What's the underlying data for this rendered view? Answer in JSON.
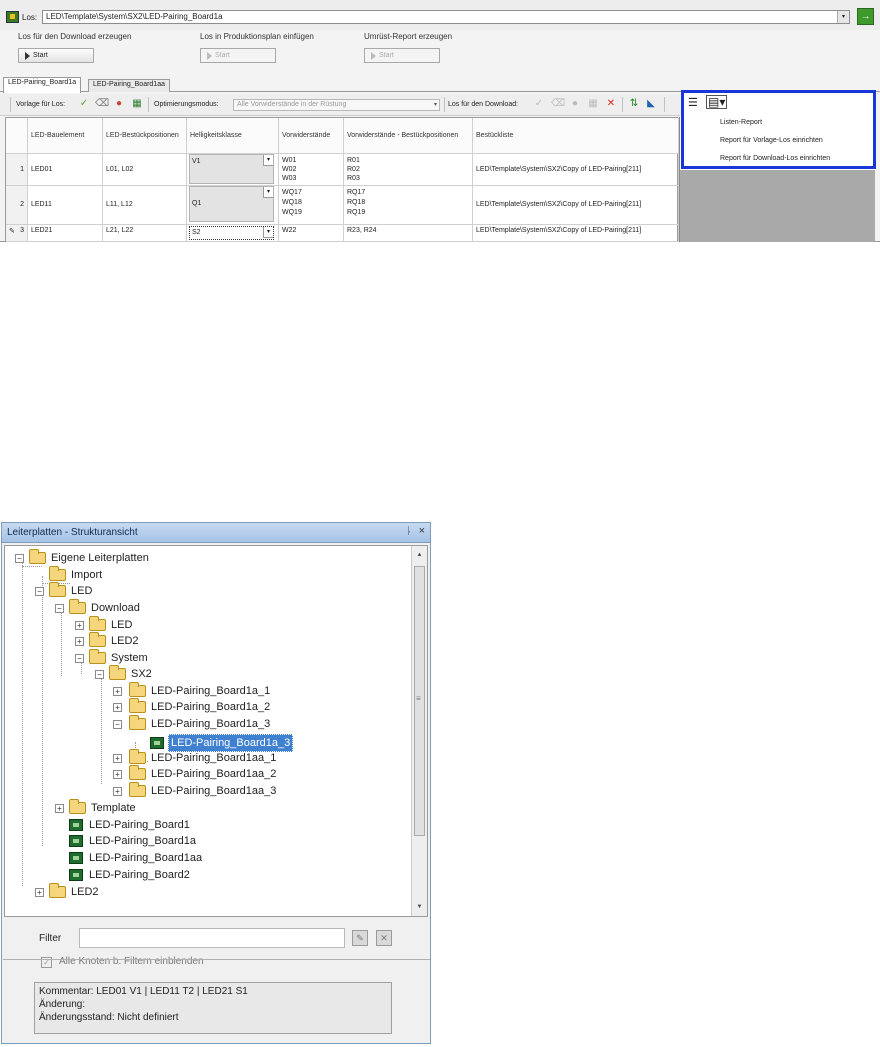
{
  "los": {
    "label": "Los:",
    "value": "LED\\Template\\System\\SX2\\LED-Pairing_Board1a",
    "arrow": "▾",
    "go": "→"
  },
  "actions": [
    {
      "title": "Los für den Download erzeugen",
      "button": "Start",
      "enabled": true
    },
    {
      "title": "Los in Produktionsplan einfügen",
      "button": "Start",
      "enabled": false
    },
    {
      "title": "Umrüst-Report erzeugen",
      "button": "Start",
      "enabled": false
    }
  ],
  "doc_tabs": [
    "LED-Pairing_Board1a",
    "LED-Pairing_Board1aa"
  ],
  "toolbar": {
    "vorlage_label": "Vorlage für Los:",
    "optimierung_label": "Optimierungsmodus:",
    "optimierung_value": "Alle Vorwiderstände in der Rüstung",
    "download_label": "Los für den Download:"
  },
  "grid": {
    "headers": [
      "LED-Bauelement",
      "LED-Bestückpositionen",
      "Helligkeitsklasse",
      "Vorwiderstände",
      "Vorwiderstände - Bestückpositionen",
      "Bestückliste"
    ],
    "rows": [
      {
        "num": "1",
        "led": "LED01",
        "pos": "L01, L02",
        "klasse": "V1",
        "vorw": "W01\nW02\nW03",
        "vorw_pos": "R01\nR02\nR03",
        "liste": "LED\\Template\\System\\SX2\\Copy of LED-Pairing[211]"
      },
      {
        "num": "2",
        "led": "LED11",
        "pos": "L11, L12",
        "klasse": "Q1",
        "vorw": "WQ17\nWQ18\nWQ19",
        "vorw_pos": "RQ17\nRQ18\nRQ19",
        "liste": "LED\\Template\\System\\SX2\\Copy of LED-Pairing[211]"
      },
      {
        "num": "3",
        "led": "LED21",
        "pos": "L21, L22",
        "klasse": "S2",
        "vorw": "W22",
        "vorw_pos": "R23, R24",
        "liste": "LED\\Template\\System\\SX2\\Copy of LED-Pairing[211]"
      }
    ]
  },
  "report_menu": {
    "items": [
      "Listen-Report",
      "Report für Vorlage-Los einrichten",
      "Report für Download-Los einrichten"
    ],
    "highlight_color": "#1b36d6"
  },
  "tree_panel": {
    "title": "Leiterplatten - Strukturansicht",
    "pin": "ᚿ",
    "close": "×",
    "nodes": [
      "Eigene Leiterplatten",
      "Import",
      "LED",
      "Download",
      "LED",
      "LED2",
      "System",
      "SX2",
      "LED-Pairing_Board1a_1",
      "LED-Pairing_Board1a_2",
      "LED-Pairing_Board1a_3",
      "LED-Pairing_Board1a_3",
      "LED-Pairing_Board1aa_1",
      "LED-Pairing_Board1aa_2",
      "LED-Pairing_Board1aa_3",
      "Template",
      "LED-Pairing_Board1",
      "LED-Pairing_Board1a",
      "LED-Pairing_Board1aa",
      "LED-Pairing_Board2",
      "LED2"
    ],
    "selected_color": "#3f80d0",
    "filter_label": "Filter",
    "filter_value": "",
    "show_all_label": "Alle Knoten b. Filtern einblenden",
    "info_lines": [
      "Kommentar: LED01   V1  |  LED11   T2  |  LED21   S1",
      "Änderung:",
      "Änderungsstand: Nicht definiert"
    ]
  }
}
